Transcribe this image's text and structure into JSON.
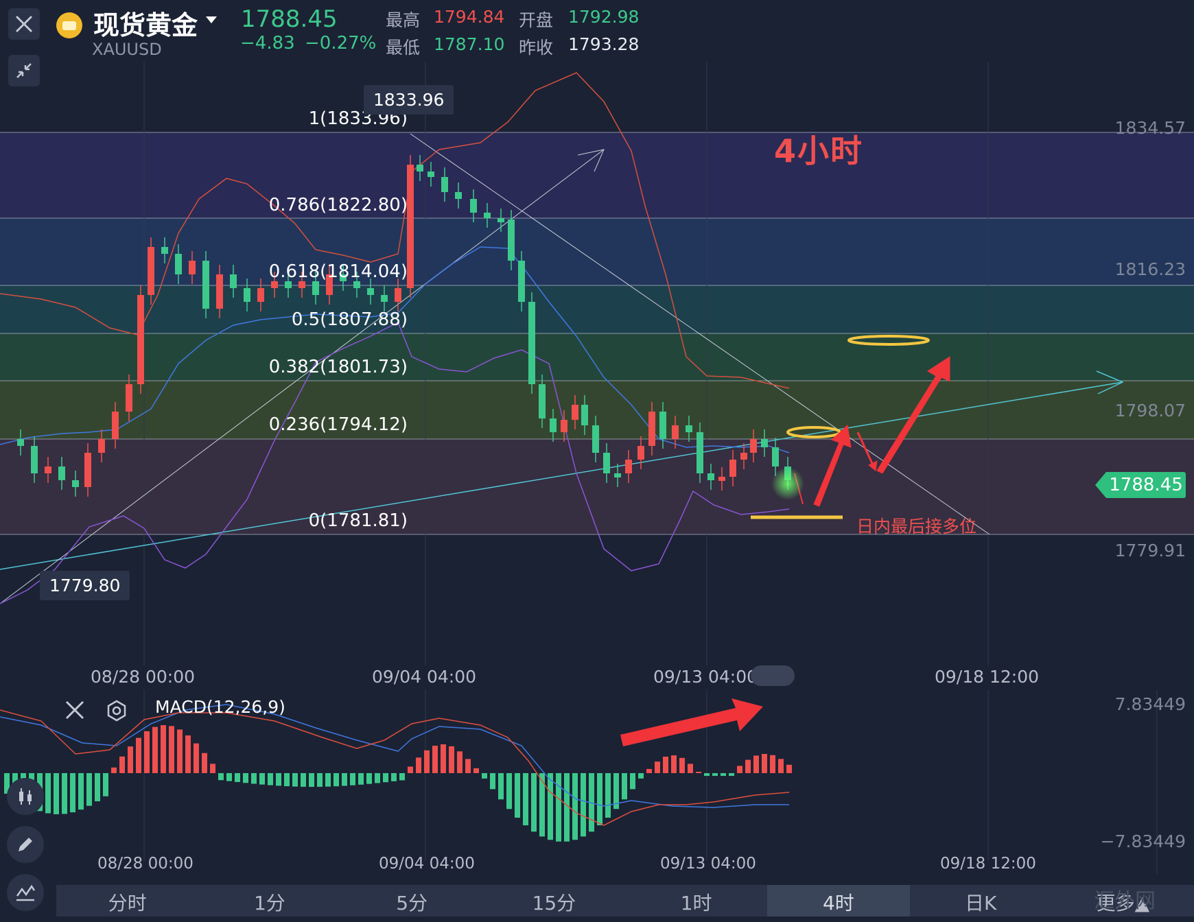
{
  "header": {
    "name": "现货黄金",
    "symbol": "XAUUSD",
    "price": "1788.45",
    "change": "−4.83",
    "change_pct": "−0.27%",
    "high_label": "最高",
    "high_value": "1794.84",
    "low_label": "最低",
    "low_value": "1787.10",
    "open_label": "开盘",
    "open_value": "1792.98",
    "prev_close_label": "昨收",
    "prev_close_value": "1793.28"
  },
  "chart": {
    "y_ticks": [
      "1834.57",
      "1816.23",
      "1798.07",
      "1779.91"
    ],
    "x_ticks": [
      "08/28 00:00",
      "09/04 04:00",
      "09/13 04:00",
      "09/18 12:00"
    ],
    "current_price_tag": "1788.45",
    "high_tag": "1833.96",
    "low_tag": "1779.80",
    "fib_levels": [
      {
        "label": "1(1833.96)",
        "value": 1833.96
      },
      {
        "label": "0.786(1822.80)",
        "value": 1822.8
      },
      {
        "label": "0.618(1814.04)",
        "value": 1814.04
      },
      {
        "label": "0.5(1807.88)",
        "value": 1807.88
      },
      {
        "label": "0.382(1801.73)",
        "value": 1801.73
      },
      {
        "label": "0.236(1794.12)",
        "value": 1794.12
      },
      {
        "label": "0(1781.81)",
        "value": 1781.81
      }
    ],
    "annotation_timeframe": "4小时",
    "annotation_note": "日内最后接多位",
    "colors": {
      "up": "#f0504e",
      "down": "#3dc98c",
      "bg": "#1b2234"
    }
  },
  "macd": {
    "title": "MACD(12,26,9)",
    "y_top": "7.83449",
    "y_bottom": "−7.83449",
    "x_ticks": [
      "08/28 00:00",
      "09/04 04:00",
      "09/13 04:00",
      "09/18 12:00"
    ]
  },
  "tabs": [
    {
      "label": "分时"
    },
    {
      "label": "1分"
    },
    {
      "label": "5分"
    },
    {
      "label": "15分"
    },
    {
      "label": "1时"
    },
    {
      "label": "4时",
      "active": true
    },
    {
      "label": "日K"
    },
    {
      "label": "更多▲"
    }
  ],
  "watermark": "汇外网",
  "icons": [
    "close-icon",
    "collapse-icon",
    "settings-icon",
    "candlestick-icon",
    "pencil-icon",
    "indicator-icon"
  ]
}
